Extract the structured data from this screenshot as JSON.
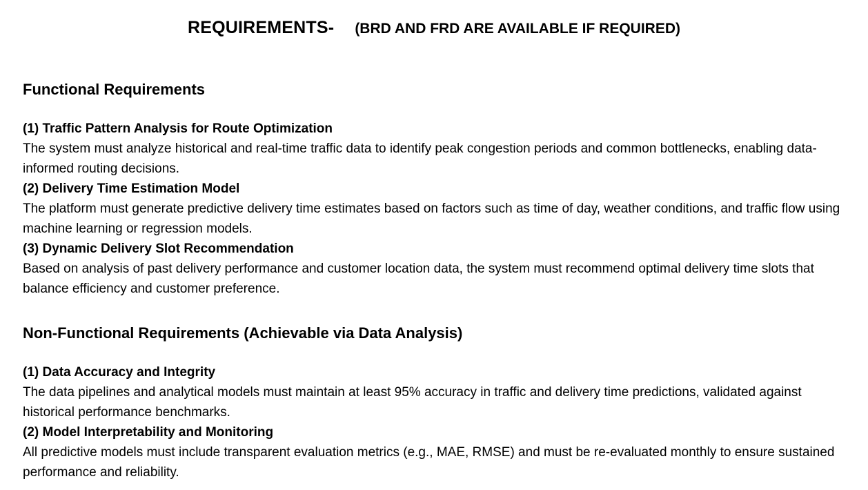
{
  "title": {
    "main": "REQUIREMENTS-",
    "note": "(BRD AND FRD ARE AVAILABLE IF REQUIRED)"
  },
  "functional": {
    "heading": "Functional Requirements",
    "items": [
      {
        "title": "(1) Traffic Pattern Analysis for Route Optimization",
        "body": "The system must analyze historical and real-time traffic data to identify peak congestion periods and common bottlenecks, enabling data-informed routing decisions."
      },
      {
        "title": "(2) Delivery Time Estimation Model",
        "body": "The platform must generate predictive delivery time estimates based on factors such as time of day, weather conditions, and traffic flow using machine learning or regression models."
      },
      {
        "title": "(3) Dynamic Delivery Slot Recommendation",
        "body": "Based on analysis of past delivery performance and customer location data, the system must recommend optimal delivery time slots that balance efficiency and customer preference."
      }
    ]
  },
  "non_functional": {
    "heading": "Non-Functional Requirements (Achievable via Data Analysis)",
    "items": [
      {
        "title": "(1) Data Accuracy and Integrity",
        "body": "The data pipelines and analytical models must maintain at least 95% accuracy in traffic and delivery time predictions, validated against historical performance benchmarks."
      },
      {
        "title": "(2) Model Interpretability and Monitoring",
        "body": "All predictive models must include transparent evaluation metrics (e.g., MAE, RMSE) and must be re-evaluated monthly to ensure sustained performance and reliability."
      }
    ]
  }
}
